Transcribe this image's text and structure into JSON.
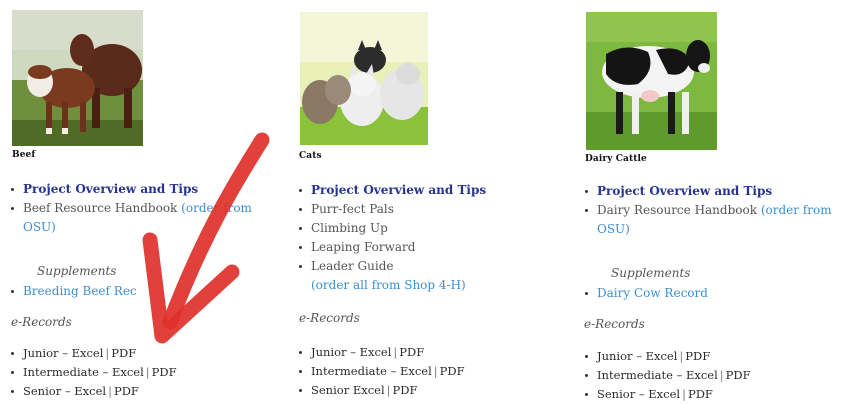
{
  "columns": [
    {
      "id": "beef",
      "caption": "Beef",
      "overview": "Project Overview and Tips",
      "handbook_text": "Beef Resource Handbook",
      "handbook_link": "(order from",
      "handbook_link_cont": "OSU)",
      "supplements_label": "Supplements",
      "supplement_link": "Breeding Beef Rec",
      "erecords_label": "e-Records",
      "erecords": [
        {
          "level": "Junior",
          "dash": "–",
          "excel": "Excel",
          "pdf": "PDF"
        },
        {
          "level": "Intermediate",
          "dash": "–",
          "excel": "Excel",
          "pdf": "PDF"
        },
        {
          "level": "Senior",
          "dash": "–",
          "excel": "Excel",
          "pdf": "PDF"
        }
      ]
    },
    {
      "id": "cats",
      "caption": "Cats",
      "overview": "Project Overview and Tips",
      "items": [
        "Purr-fect Pals",
        "Climbing Up",
        "Leaping Forward",
        "Leader Guide"
      ],
      "order_link": "(order all from Shop 4-H)",
      "erecords_label": "e-Records",
      "erecords": [
        {
          "level": "Junior",
          "dash": "–",
          "excel": "Excel",
          "pdf": "PDF"
        },
        {
          "level": "Intermediate",
          "dash": "–",
          "excel": "Excel",
          "pdf": "PDF"
        },
        {
          "level": "Senior",
          "dash": "",
          "excel": "Excel",
          "pdf": "PDF"
        }
      ]
    },
    {
      "id": "dairy",
      "caption": "Dairy Cattle",
      "overview": "Project Overview and Tips",
      "handbook_text": "Dairy Resource Handbook",
      "handbook_link": "(order from",
      "handbook_link_cont": "OSU)",
      "supplements_label": "Supplements",
      "supplement_link": "Dairy Cow Record",
      "erecords_label": "e-Records",
      "erecords": [
        {
          "level": "Junior",
          "dash": "–",
          "excel": "Excel",
          "pdf": "PDF"
        },
        {
          "level": "Intermediate",
          "dash": "–",
          "excel": "Excel",
          "pdf": "PDF"
        },
        {
          "level": "Senior",
          "dash": "–",
          "excel": "Excel",
          "pdf": "PDF"
        }
      ]
    }
  ],
  "colors": {
    "primary_link": "#26348f",
    "secondary_link": "#3d8ed1",
    "arrow": "#e0302a"
  }
}
